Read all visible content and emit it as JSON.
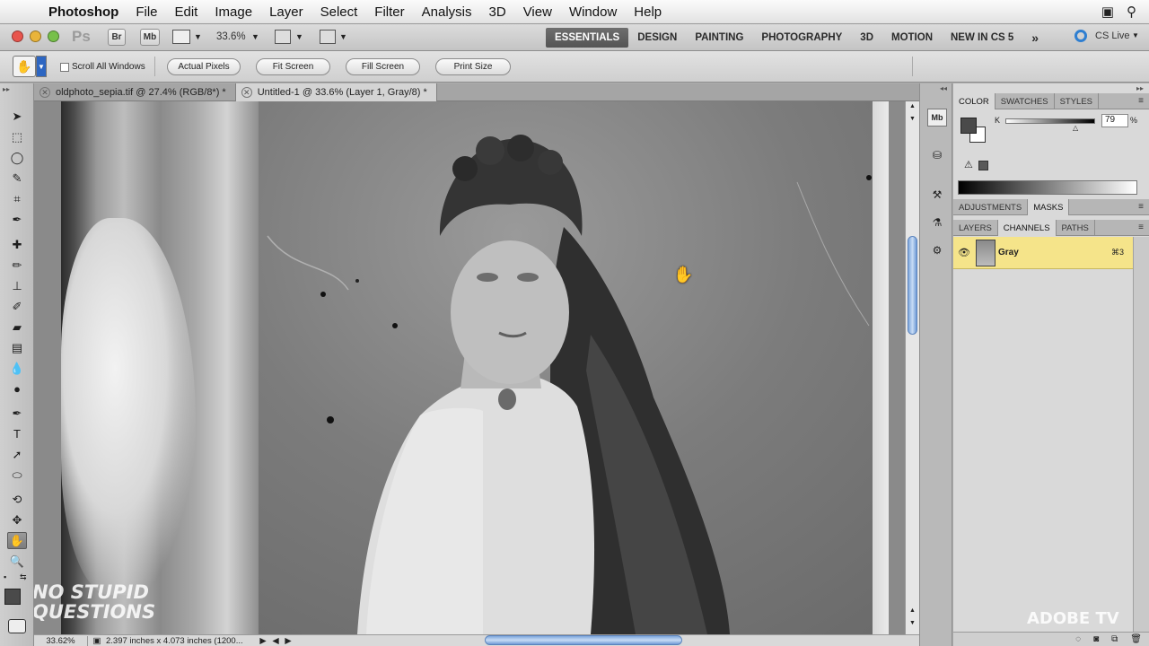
{
  "menubar": {
    "apple_icon": "apple-logo",
    "app_name": "Photoshop",
    "items": [
      "File",
      "Edit",
      "Image",
      "Layer",
      "Select",
      "Filter",
      "Analysis",
      "3D",
      "View",
      "Window",
      "Help"
    ]
  },
  "appbar": {
    "ps_logo": "Ps",
    "bridge": "Br",
    "minibridge": "Mb",
    "zoom": "33.6%",
    "workspaces": [
      "ESSENTIALS",
      "DESIGN",
      "PAINTING",
      "PHOTOGRAPHY",
      "3D",
      "MOTION",
      "NEW IN CS 5"
    ],
    "active_workspace": "ESSENTIALS",
    "more": "»",
    "cslive": "CS Live"
  },
  "options": {
    "scroll_all_windows": "Scroll All Windows",
    "actual_pixels": "Actual Pixels",
    "fit_screen": "Fit Screen",
    "fill_screen": "Fill Screen",
    "print_size": "Print Size"
  },
  "tabs": [
    {
      "label": "oldphoto_sepia.tif @ 27.4% (RGB/8*) *",
      "active": false
    },
    {
      "label": "Untitled-1 @ 33.6% (Layer 1, Gray/8) *",
      "active": true
    }
  ],
  "status": {
    "zoom": "33.62%",
    "doc_info": "2.397 inches x 4.073 inches (1200..."
  },
  "color_panel": {
    "tabs": [
      "COLOR",
      "SWATCHES",
      "STYLES"
    ],
    "active": "COLOR",
    "channel": "K",
    "value": "79",
    "unit": "%"
  },
  "adjust_panel": {
    "tabs": [
      "ADJUSTMENTS",
      "MASKS"
    ],
    "active": "MASKS"
  },
  "layers_panel": {
    "tabs": [
      "LAYERS",
      "CHANNELS",
      "PATHS"
    ],
    "active": "CHANNELS",
    "channel_name": "Gray",
    "shortcut": "⌘3"
  },
  "watermark": {
    "left_line1": "NO STUPID",
    "left_line2": "QUESTIONS",
    "right": "ADOBE TV"
  },
  "colors": {
    "highlight_row": "#f5e48a",
    "accent_blue": "#5b84bd"
  }
}
